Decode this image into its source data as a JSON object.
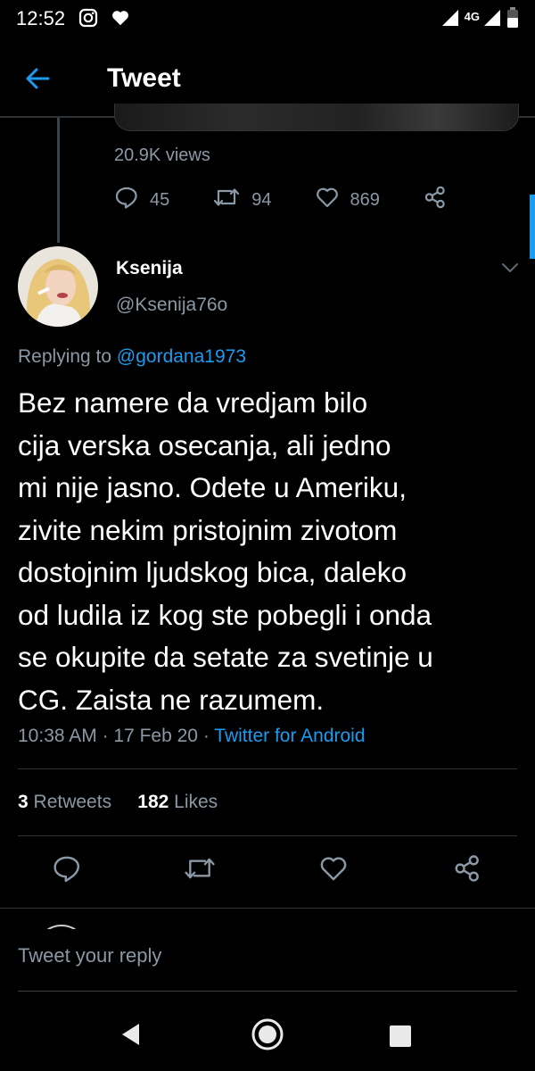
{
  "status": {
    "time": "12:52",
    "network": "4G"
  },
  "header": {
    "title": "Tweet"
  },
  "previous_tweet": {
    "views": "20.9K views",
    "replies": "45",
    "retweets": "94",
    "likes": "869"
  },
  "tweet": {
    "name": "Ksenija",
    "handle": "@Ksenija76o",
    "replying_prefix": "Replying to",
    "replying_to": "@gordana1973",
    "body_lines": [
      "Bez namere da vredjam bilo",
      "cija verska osecanja, ali jedno",
      "mi nije jasno. Odete u Ameriku,",
      "zivite nekim pristojnim zivotom",
      "dostojnim ljudskog bica, daleko",
      "od ludila iz kog ste pobegli i onda",
      "se okupite da setate za svetinje u",
      "CG. Zaista ne razumem."
    ],
    "time": "10:38 AM",
    "date": "17 Feb 20",
    "source": "Twitter for Android",
    "retweet_count": "3",
    "retweet_label": "Retweets",
    "like_count": "182",
    "like_label": "Likes"
  },
  "reply": {
    "placeholder": "Tweet your reply"
  },
  "icons": [
    "instagram-icon",
    "heart-icon",
    "signal-icon",
    "battery-icon",
    "back-arrow-icon",
    "comment-icon",
    "retweet-icon",
    "share-icon",
    "chevron-down-icon",
    "nav-back-icon",
    "nav-home-icon",
    "nav-recents-icon"
  ],
  "colors": {
    "accent": "#1d9bf0",
    "background": "#000000",
    "muted": "#8b98a5"
  }
}
